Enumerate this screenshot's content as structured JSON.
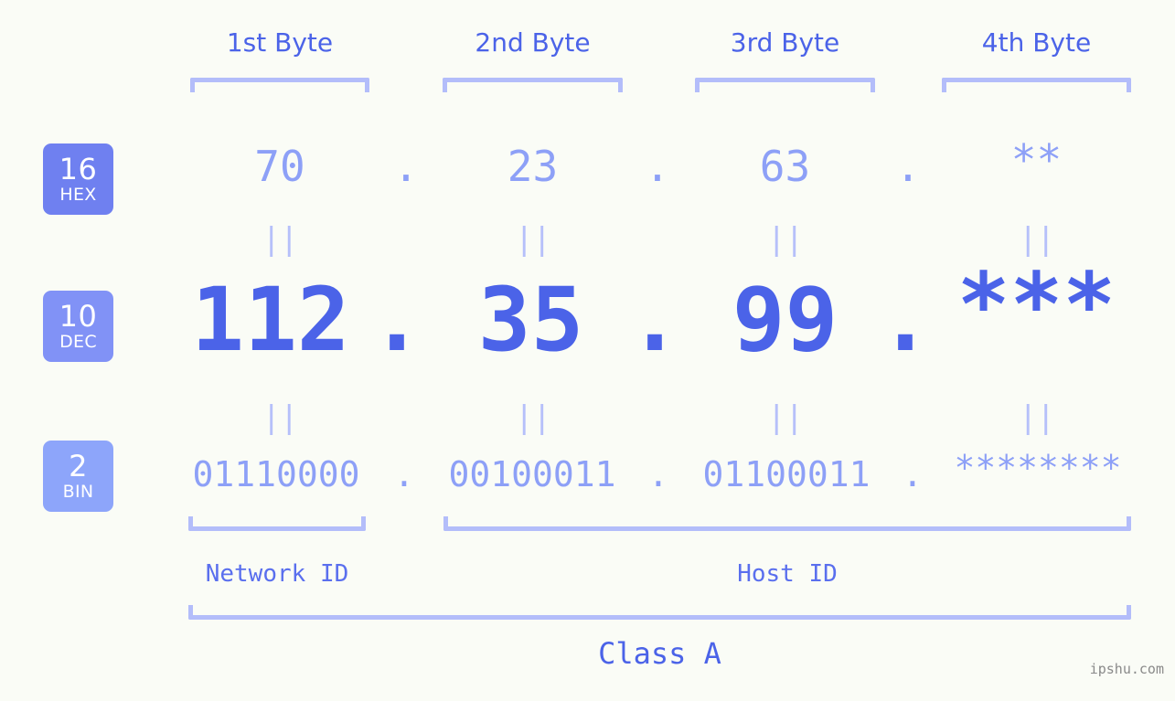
{
  "background_color": "#fafcf6",
  "accent_color": "#4b63e8",
  "bracket_color": "#b3bdfa",
  "muted_value_color": "#8da0f7",
  "byte_headers": [
    {
      "label": "1st Byte"
    },
    {
      "label": "2nd Byte"
    },
    {
      "label": "3rd Byte"
    },
    {
      "label": "4th Byte"
    }
  ],
  "bases": [
    {
      "number": "16",
      "name": "HEX",
      "color": "#6f80f0"
    },
    {
      "number": "10",
      "name": "DEC",
      "color": "#8192f6"
    },
    {
      "number": "2",
      "name": "BIN",
      "color": "#8da5fa"
    }
  ],
  "rows": {
    "hex": {
      "values": [
        "70",
        "23",
        "63",
        "**"
      ],
      "separator": "."
    },
    "dec": {
      "values": [
        "112",
        "35",
        "99",
        "***"
      ],
      "separator": "."
    },
    "bin": {
      "values": [
        "01110000",
        "00100011",
        "01100011",
        "********"
      ],
      "separator": "."
    }
  },
  "equals_glyph": "||",
  "footer": {
    "network_id_label": "Network ID",
    "host_id_label": "Host ID",
    "class_label": "Class A",
    "watermark": "ipshu.com"
  },
  "chart_data": {
    "type": "table",
    "title": "IP address byte breakdown",
    "columns": [
      "1st Byte",
      "2nd Byte",
      "3rd Byte",
      "4th Byte"
    ],
    "rows": [
      {
        "base": "16",
        "base_name": "HEX",
        "cells": [
          "70",
          "23",
          "63",
          "**"
        ]
      },
      {
        "base": "10",
        "base_name": "DEC",
        "cells": [
          "112",
          "35",
          "99",
          "***"
        ]
      },
      {
        "base": "2",
        "base_name": "BIN",
        "cells": [
          "01110000",
          "00100011",
          "01100011",
          "********"
        ]
      }
    ],
    "network_id_bytes": 1,
    "host_id_bytes": 3,
    "class": "Class A"
  }
}
